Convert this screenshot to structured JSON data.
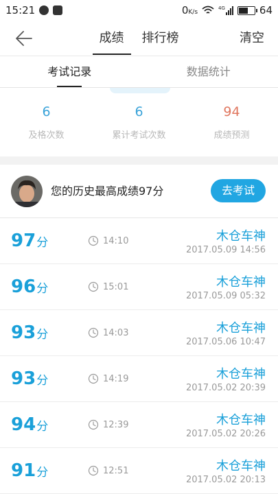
{
  "status_bar": {
    "time": "15:21",
    "network_speed": "0",
    "speed_unit": "K/s",
    "signal_label": "4G",
    "battery": "64",
    "battery_level": 0.64
  },
  "nav": {
    "tabs": [
      "成绩",
      "排行榜"
    ],
    "active_tab": 0,
    "clear_label": "清空"
  },
  "sub_tabs": {
    "items": [
      "考试记录",
      "数据统计"
    ],
    "active": 0
  },
  "stats": [
    {
      "value": "6",
      "label": "及格次数"
    },
    {
      "value": "6",
      "label": "累计考试次数"
    },
    {
      "value": "94",
      "label": "成绩预测"
    }
  ],
  "best": {
    "text": "您的历史最高成绩97分",
    "button": "去考试"
  },
  "records": [
    {
      "score": "97",
      "unit": "分",
      "duration": "14:10",
      "name": "木仓车神",
      "datetime": "2017.05.09  14:56"
    },
    {
      "score": "96",
      "unit": "分",
      "duration": "15:01",
      "name": "木仓车神",
      "datetime": "2017.05.09  05:32"
    },
    {
      "score": "93",
      "unit": "分",
      "duration": "14:03",
      "name": "木仓车神",
      "datetime": "2017.05.06  10:47"
    },
    {
      "score": "93",
      "unit": "分",
      "duration": "14:19",
      "name": "木仓车神",
      "datetime": "2017.05.02  20:39"
    },
    {
      "score": "94",
      "unit": "分",
      "duration": "12:39",
      "name": "木仓车神",
      "datetime": "2017.05.02  20:26"
    },
    {
      "score": "91",
      "unit": "分",
      "duration": "12:51",
      "name": "木仓车神",
      "datetime": "2017.05.02  20:13"
    }
  ]
}
